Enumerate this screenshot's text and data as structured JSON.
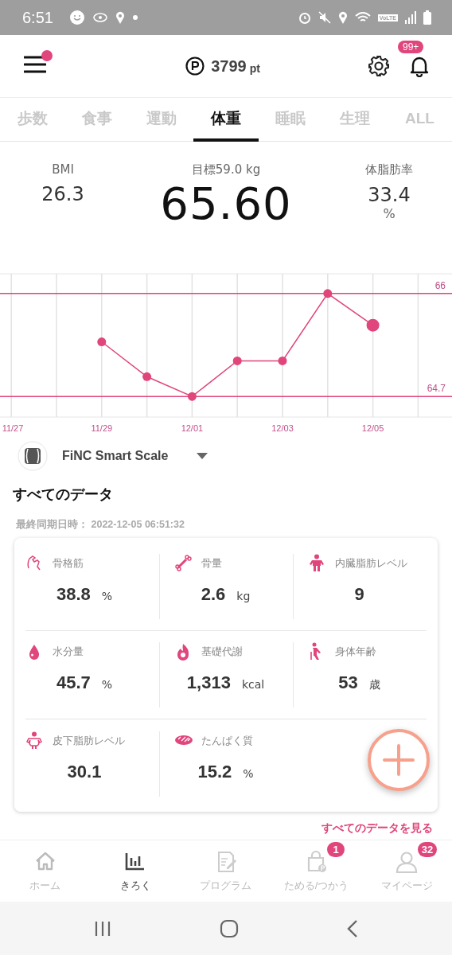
{
  "status_bar": {
    "time": "6:51",
    "network_label": "VoLTE"
  },
  "header": {
    "menu_dot": true,
    "points": "3799",
    "points_unit": "pt",
    "notification_badge": "99+"
  },
  "tabs": [
    {
      "label": "歩数",
      "selected": false
    },
    {
      "label": "食事",
      "selected": false
    },
    {
      "label": "運動",
      "selected": false
    },
    {
      "label": "体重",
      "selected": true
    },
    {
      "label": "睡眠",
      "selected": false
    },
    {
      "label": "生理",
      "selected": false
    },
    {
      "label": "ALL",
      "selected": false
    }
  ],
  "summary": {
    "left": {
      "label": "BMI",
      "value": "26.3"
    },
    "center": {
      "label": "目標59.0 kg",
      "value": "65.60"
    },
    "right": {
      "label": "体脂肪率",
      "value": "33.4",
      "unit": "%"
    }
  },
  "chart_data": {
    "type": "line",
    "categories": [
      "11/27",
      null,
      "11/29",
      null,
      "12/01",
      null,
      "12/03",
      null,
      "12/05",
      null
    ],
    "grid": true,
    "series": [
      {
        "color": "#e0457b",
        "marker": true,
        "values": [
          null,
          null,
          65.39,
          64.95,
          64.7,
          65.15,
          65.15,
          66.0,
          65.6,
          null
        ]
      }
    ],
    "ylim": [
      64.44,
      66.25
    ],
    "yticks": [
      66,
      64.7
    ]
  },
  "device": {
    "name": "FiNC Smart Scale"
  },
  "section_title": "すべてのデータ",
  "sync_text": "最終同期日時： 2022-12-05 06:51:32",
  "metrics": [
    {
      "kind": "muscle",
      "label": "骨格筋",
      "value": "38.8",
      "unit": "%"
    },
    {
      "kind": "bone",
      "label": "骨量",
      "value": "2.6",
      "unit": "kg"
    },
    {
      "kind": "visceral",
      "label": "内臓脂肪レベル",
      "value": "9"
    },
    {
      "kind": "water",
      "label": "水分量",
      "value": "45.7",
      "unit": "%"
    },
    {
      "kind": "fire",
      "label": "基礎代謝",
      "value": "1,313",
      "unit": "kcal"
    },
    {
      "kind": "age",
      "label": "身体年齢",
      "value": "53",
      "unit": "歳"
    },
    {
      "kind": "subcutaneous",
      "label": "皮下脂肪レベル",
      "value": "30.1"
    },
    {
      "kind": "protein",
      "label": "たんぱく質",
      "value": "15.2",
      "unit": "%"
    }
  ],
  "see_all_link": "すべてのデータを見る",
  "nav": [
    {
      "kind": "home",
      "label": "ホーム",
      "selected": false
    },
    {
      "kind": "record",
      "label": "きろく",
      "selected": true
    },
    {
      "kind": "program",
      "label": "プログラム",
      "selected": false
    },
    {
      "kind": "points",
      "label": "ためる/つかう",
      "selected": false,
      "badge": "1"
    },
    {
      "kind": "mypage",
      "label": "マイページ",
      "selected": false,
      "badge": "32"
    }
  ]
}
